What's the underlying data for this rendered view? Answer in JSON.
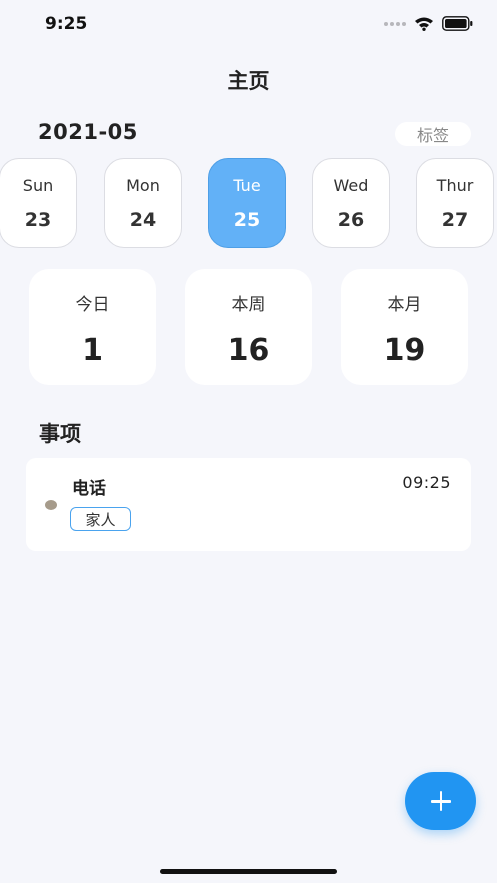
{
  "status_bar": {
    "time": "9:25",
    "icons": [
      "signal-icon",
      "wifi-icon",
      "battery-icon"
    ]
  },
  "header": {
    "title": "主页"
  },
  "calendar": {
    "month": "2021-05",
    "tag_button_label": "标签",
    "days": [
      {
        "name": "Sun",
        "date": "23",
        "selected": false
      },
      {
        "name": "Mon",
        "date": "24",
        "selected": false
      },
      {
        "name": "Tue",
        "date": "25",
        "selected": true
      },
      {
        "name": "Wed",
        "date": "26",
        "selected": false
      },
      {
        "name": "Thur",
        "date": "27",
        "selected": false
      }
    ]
  },
  "stats": [
    {
      "label": "今日",
      "value": "1"
    },
    {
      "label": "本周",
      "value": "16"
    },
    {
      "label": "本月",
      "value": "19"
    }
  ],
  "events": {
    "section_title": "事项",
    "items": [
      {
        "title": "电话",
        "time": "09:25",
        "tag": "家人"
      }
    ]
  },
  "fab": {
    "icon": "plus-icon"
  },
  "colors": {
    "accent": "#2195f2",
    "selected_day": "#62b1f7",
    "background": "#f5f6fb",
    "tag_border": "#4aa3ee",
    "event_dot": "#a69b8b"
  }
}
